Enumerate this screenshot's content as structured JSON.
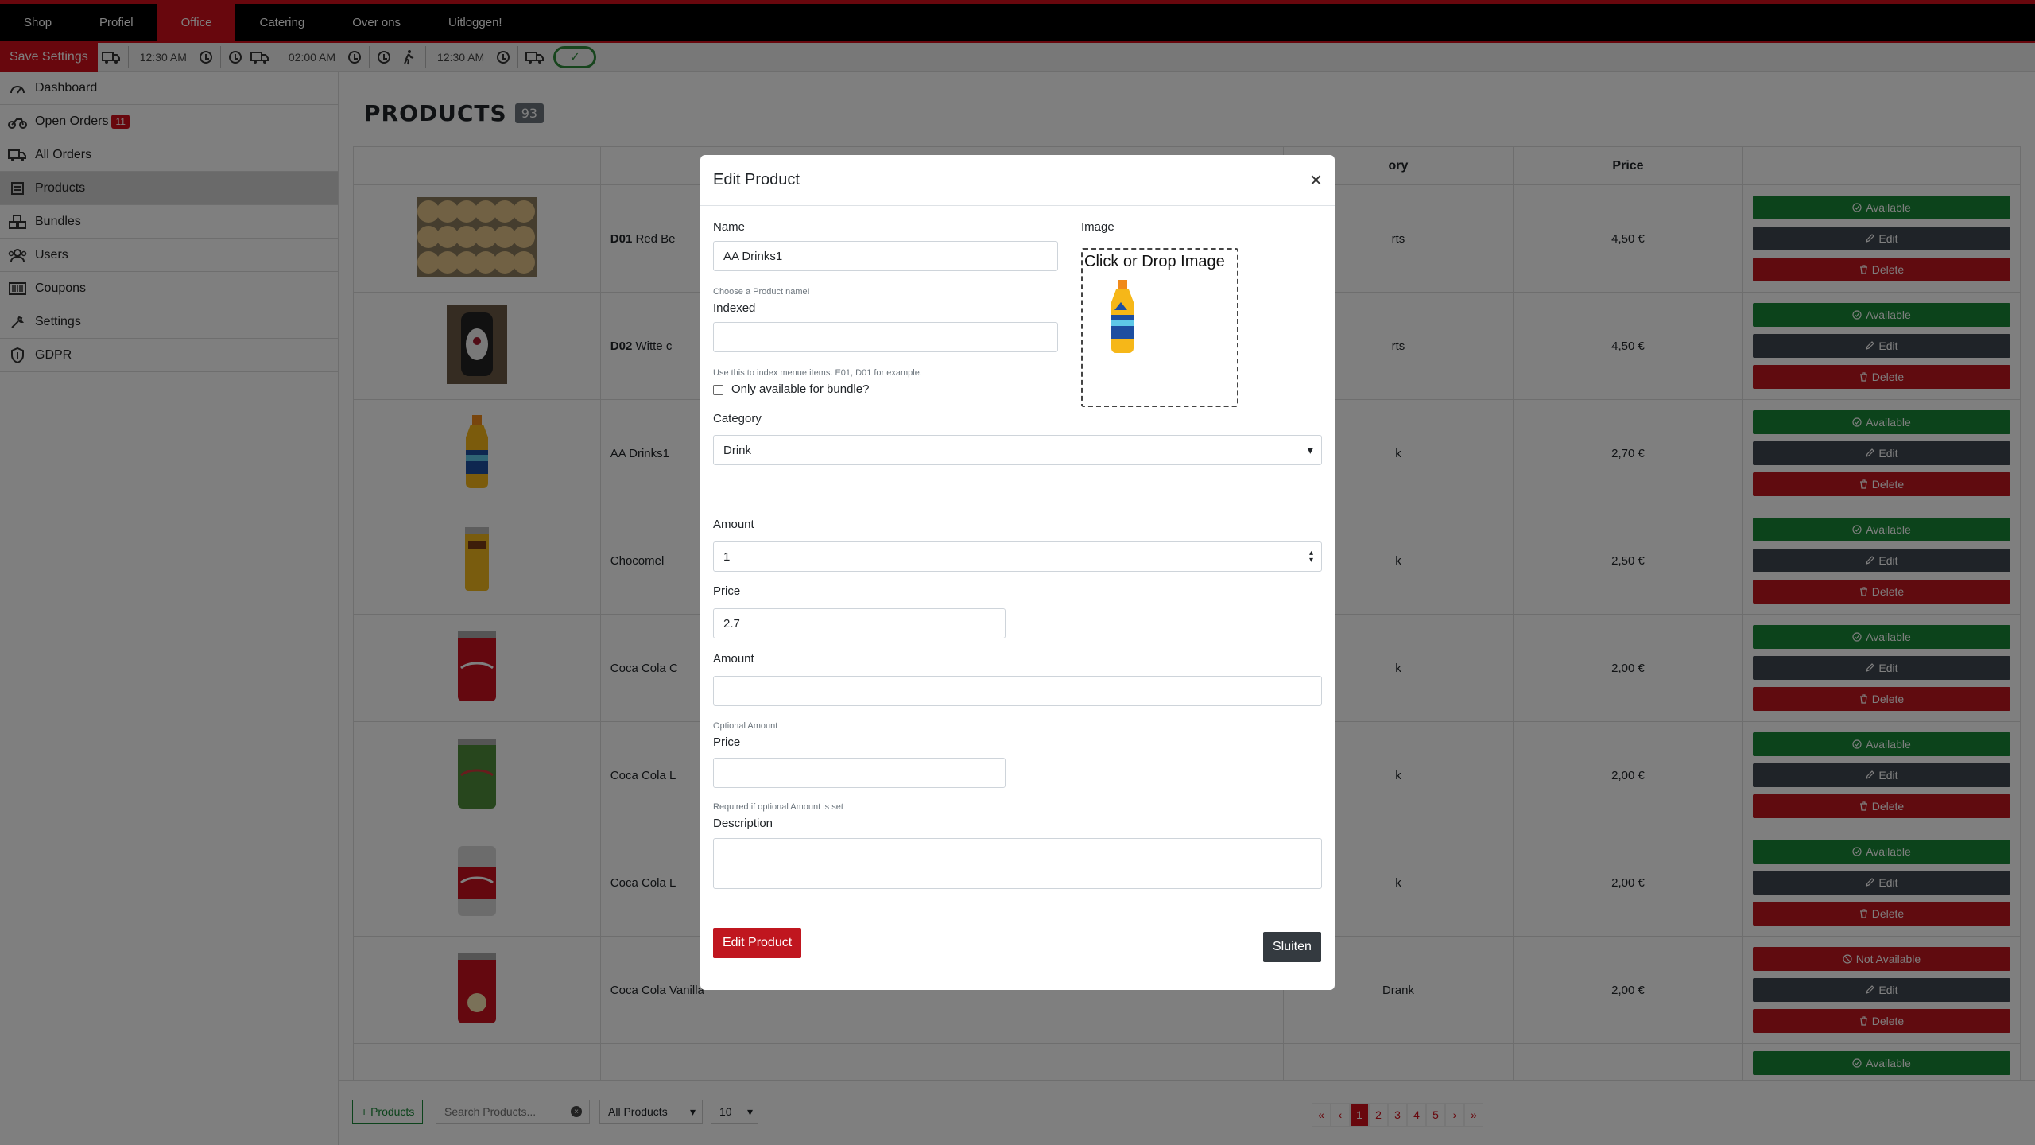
{
  "nav": [
    "Shop",
    "Profiel",
    "Office",
    "Catering",
    "Over ons",
    "Uitloggen!"
  ],
  "toolbar": {
    "save_label": "Save Settings",
    "time1": "12:30 AM",
    "time2": "02:00 AM",
    "time3": "12:30 AM",
    "toggle_symbol": "✓"
  },
  "sidebar": [
    {
      "label": "Dashboard",
      "icon": "dashboard-gauge-icon"
    },
    {
      "label": "Open Orders",
      "icon": "delivery-bike-icon",
      "badge": "11"
    },
    {
      "label": "All Orders",
      "icon": "delivery-truck-icon"
    },
    {
      "label": "Products",
      "icon": "product-box-icon"
    },
    {
      "label": "Bundles",
      "icon": "boxes-icon"
    },
    {
      "label": "Users",
      "icon": "users-icon"
    },
    {
      "label": "Coupons",
      "icon": "barcode-icon"
    },
    {
      "label": "Settings",
      "icon": "wrench-icon"
    },
    {
      "label": "GDPR",
      "icon": "shield-icon"
    }
  ],
  "page": {
    "title": "PRODUCTS",
    "count": "93"
  },
  "table": {
    "headers": [
      "",
      "",
      "",
      "ory",
      "Price",
      ""
    ],
    "rows": [
      {
        "code": "D01",
        "name": "Red Be",
        "category": "rts",
        "price": "4,50 €",
        "status": "Available",
        "image": "cheese-balls"
      },
      {
        "code": "D02",
        "name": "Witte c",
        "category": "rts",
        "price": "4,50 €",
        "status": "Available",
        "image": "dessert-tray"
      },
      {
        "code": "",
        "name": "AA Drinks1",
        "category": "k",
        "price": "2,70 €",
        "status": "Available",
        "image": "aa-drink-bottle"
      },
      {
        "code": "",
        "name": "Chocomel",
        "category": "k",
        "price": "2,50 €",
        "status": "Available",
        "image": "chocomel-can"
      },
      {
        "code": "",
        "name": "Coca Cola C",
        "category": "k",
        "price": "2,00 €",
        "status": "Available",
        "image": "coca-cola-can"
      },
      {
        "code": "",
        "name": "Coca Cola L",
        "category": "k",
        "price": "2,00 €",
        "status": "Available",
        "image": "coca-cola-life-can"
      },
      {
        "code": "",
        "name": "Coca Cola L",
        "category": "k",
        "price": "2,00 €",
        "status": "Available",
        "image": "coca-cola-light-can"
      },
      {
        "code": "",
        "name": "Coca Cola Vanilla",
        "category": "Drank",
        "price": "2,00 €",
        "status": "Not Available",
        "image": "coca-cola-vanilla-can"
      },
      {
        "code": "",
        "name": "",
        "category": "",
        "price": "",
        "status": "Available",
        "image": "purple-can"
      }
    ],
    "edit_label": "Edit",
    "delete_label": "Delete"
  },
  "bottom": {
    "add_label": "+ Products",
    "search_placeholder": "Search Products...",
    "filter_value": "All Products",
    "per_page": "10",
    "pages": [
      "«",
      "‹",
      "1",
      "2",
      "3",
      "4",
      "5",
      "›",
      "»"
    ]
  },
  "modal": {
    "title": "Edit Product",
    "close": "×",
    "name_label": "Name",
    "name_value": "AA Drinks1",
    "name_hint": "Choose a Product name!",
    "indexed_label": "Indexed",
    "indexed_hint": "Use this to index menue items. E01, D01 for example.",
    "bundle_label": "Only available for bundle?",
    "image_label": "Image",
    "dropzone_text": "Click or Drop Image",
    "category_label": "Category",
    "category_value": "Drink",
    "amount_label": "Amount",
    "amount_value": "1",
    "price_label": "Price",
    "price_value": "2.7",
    "amount2_label": "Amount",
    "amount2_hint": "Optional Amount",
    "price2_label": "Price",
    "price2_hint": "Required if optional Amount is set",
    "description_label": "Description",
    "edit_button": "Edit Product",
    "close_button": "Sluiten"
  },
  "colors": {
    "brand_red": "#d10f1b",
    "available_green": "#198736",
    "edit_gray": "#3f4750"
  }
}
